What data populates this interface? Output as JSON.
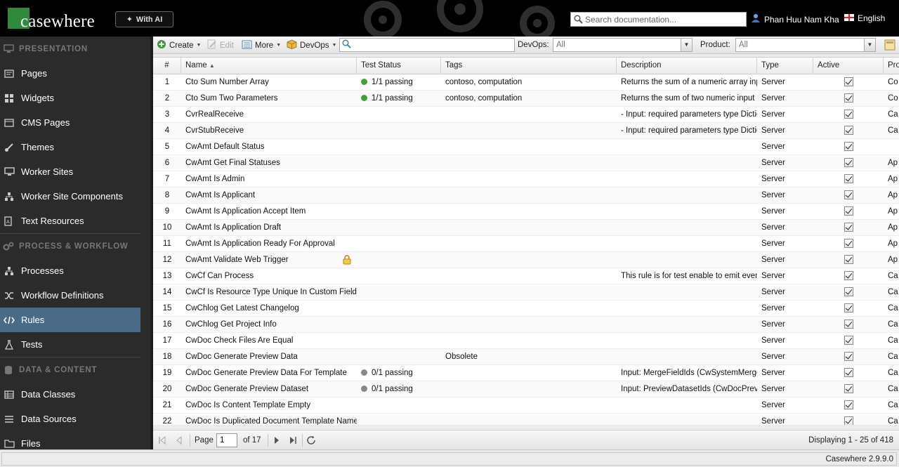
{
  "header": {
    "logo_text": "casewhere",
    "ai_button_label": "With AI",
    "search_placeholder": "Search documentation...",
    "user_name": "Phan Huu Nam Kha",
    "language": "English"
  },
  "sidebar": {
    "sections": [
      {
        "title": "PRESENTATION",
        "icon": "monitor-icon",
        "items": [
          {
            "label": "Pages",
            "icon": "pages-icon"
          },
          {
            "label": "Widgets",
            "icon": "widgets-icon"
          },
          {
            "label": "CMS Pages",
            "icon": "cms-pages-icon"
          },
          {
            "label": "Themes",
            "icon": "brush-icon"
          },
          {
            "label": "Worker Sites",
            "icon": "monitor-icon"
          },
          {
            "label": "Worker Site Components",
            "icon": "sitemap-icon"
          },
          {
            "label": "Text Resources",
            "icon": "text-resources-icon"
          }
        ]
      },
      {
        "title": "PROCESS & WORKFLOW",
        "icon": "gears-icon",
        "items": [
          {
            "label": "Processes",
            "icon": "sitemap-icon"
          },
          {
            "label": "Workflow Definitions",
            "icon": "shuffle-icon"
          },
          {
            "label": "Rules",
            "icon": "code-icon",
            "active": true
          },
          {
            "label": "Tests",
            "icon": "flask-icon"
          }
        ]
      },
      {
        "title": "DATA & CONTENT",
        "icon": "database-icon",
        "items": [
          {
            "label": "Data Classes",
            "icon": "table-icon"
          },
          {
            "label": "Data Sources",
            "icon": "list-icon"
          },
          {
            "label": "Files",
            "icon": "folder-icon"
          }
        ]
      }
    ]
  },
  "toolbar": {
    "create_label": "Create",
    "edit_label": "Edit",
    "more_label": "More",
    "devops_label": "DevOps",
    "filter_value": "",
    "devops_filter_label": "DevOps:",
    "devops_filter_value": "All",
    "product_filter_label": "Product:",
    "product_filter_value": "All"
  },
  "grid": {
    "columns": [
      "#",
      "Name",
      "Test Status",
      "Tags",
      "Description",
      "Type",
      "Active",
      "Pro"
    ],
    "sort_indicator": "▲",
    "rows": [
      {
        "n": "1",
        "name": "Cto Sum Number Array",
        "status": "1/1 passing",
        "status_color": "green",
        "tags": "contoso, computation",
        "description": "Returns the sum of a numeric array input",
        "type": "Server",
        "active": true,
        "product": "Co",
        "lock": false
      },
      {
        "n": "2",
        "name": "Cto Sum Two Parameters",
        "status": "1/1 passing",
        "status_color": "green",
        "tags": "contoso, computation",
        "description": "Returns the sum of two numeric input pa",
        "type": "Server",
        "active": true,
        "product": "Co",
        "lock": false
      },
      {
        "n": "3",
        "name": "CvrRealReceive",
        "status": "",
        "status_color": "",
        "tags": "",
        "description": "- Input: required parameters type Dictio",
        "type": "Server",
        "active": true,
        "product": "Ca",
        "lock": false
      },
      {
        "n": "4",
        "name": "CvrStubReceive",
        "status": "",
        "status_color": "",
        "tags": "",
        "description": "- Input: required parameters type Dictio",
        "type": "Server",
        "active": true,
        "product": "Ca",
        "lock": false
      },
      {
        "n": "5",
        "name": "CwAmt Default Status",
        "status": "",
        "status_color": "",
        "tags": "",
        "description": "",
        "type": "Server",
        "active": true,
        "product": "",
        "lock": false
      },
      {
        "n": "6",
        "name": "CwAmt Get Final Statuses",
        "status": "",
        "status_color": "",
        "tags": "",
        "description": "",
        "type": "Server",
        "active": true,
        "product": "Ap",
        "lock": false
      },
      {
        "n": "7",
        "name": "CwAmt Is Admin",
        "status": "",
        "status_color": "",
        "tags": "",
        "description": "",
        "type": "Server",
        "active": true,
        "product": "Ap",
        "lock": false
      },
      {
        "n": "8",
        "name": "CwAmt Is Applicant",
        "status": "",
        "status_color": "",
        "tags": "",
        "description": "",
        "type": "Server",
        "active": true,
        "product": "Ap",
        "lock": false
      },
      {
        "n": "9",
        "name": "CwAmt Is Application Accept Item",
        "status": "",
        "status_color": "",
        "tags": "",
        "description": "",
        "type": "Server",
        "active": true,
        "product": "Ap",
        "lock": false
      },
      {
        "n": "10",
        "name": "CwAmt Is Application Draft",
        "status": "",
        "status_color": "",
        "tags": "",
        "description": "",
        "type": "Server",
        "active": true,
        "product": "Ap",
        "lock": false
      },
      {
        "n": "11",
        "name": "CwAmt Is Application Ready For Approval",
        "status": "",
        "status_color": "",
        "tags": "",
        "description": "",
        "type": "Server",
        "active": true,
        "product": "Ap",
        "lock": false
      },
      {
        "n": "12",
        "name": "CwAmt Validate Web Trigger",
        "status": "",
        "status_color": "",
        "tags": "",
        "description": "",
        "type": "Server",
        "active": true,
        "product": "Ap",
        "lock": true
      },
      {
        "n": "13",
        "name": "CwCf Can Process",
        "status": "",
        "status_color": "",
        "tags": "",
        "description": "This rule is for test enable to emit event",
        "type": "Server",
        "active": true,
        "product": "Ca",
        "lock": false
      },
      {
        "n": "14",
        "name": "CwCf Is Resource Type Unique In Custom Field Co",
        "status": "",
        "status_color": "",
        "tags": "",
        "description": "",
        "type": "Server",
        "active": true,
        "product": "Ca",
        "lock": false
      },
      {
        "n": "15",
        "name": "CwChlog Get Latest Changelog",
        "status": "",
        "status_color": "",
        "tags": "",
        "description": "",
        "type": "Server",
        "active": true,
        "product": "Ca",
        "lock": false
      },
      {
        "n": "16",
        "name": "CwChlog Get Project Info",
        "status": "",
        "status_color": "",
        "tags": "",
        "description": "",
        "type": "Server",
        "active": true,
        "product": "Ca",
        "lock": false
      },
      {
        "n": "17",
        "name": "CwDoc Check Files Are Equal",
        "status": "",
        "status_color": "",
        "tags": "",
        "description": "",
        "type": "Server",
        "active": true,
        "product": "Ca",
        "lock": false
      },
      {
        "n": "18",
        "name": "CwDoc Generate Preview Data",
        "status": "",
        "status_color": "",
        "tags": "Obsolete",
        "description": "",
        "type": "Server",
        "active": true,
        "product": "Ca",
        "lock": false
      },
      {
        "n": "19",
        "name": "CwDoc Generate Preview Data For Template",
        "status": "0/1 passing",
        "status_color": "grey",
        "tags": "",
        "description": "Input: MergeFieldIds (CwSystemMergeF",
        "type": "Server",
        "active": true,
        "product": "Ca",
        "lock": false
      },
      {
        "n": "20",
        "name": "CwDoc Generate Preview Dataset",
        "status": "0/1 passing",
        "status_color": "grey",
        "tags": "",
        "description": "Input: PreviewDatasetIds (CwDocPrevie",
        "type": "Server",
        "active": true,
        "product": "Ca",
        "lock": false
      },
      {
        "n": "21",
        "name": "CwDoc Is Content Template Empty",
        "status": "",
        "status_color": "",
        "tags": "",
        "description": "",
        "type": "Server",
        "active": true,
        "product": "Ca",
        "lock": false
      },
      {
        "n": "22",
        "name": "CwDoc Is Duplicated Document Template Name",
        "status": "",
        "status_color": "",
        "tags": "",
        "description": "",
        "type": "Server",
        "active": true,
        "product": "Ca",
        "lock": false
      }
    ]
  },
  "pager": {
    "page_label": "Page",
    "page_value": "1",
    "of_label": "of 17",
    "display_text": "Displaying 1 - 25 of 418"
  },
  "footer": {
    "version": "Casewhere 2.9.9.0"
  },
  "colors": {
    "accent": "#4a6a85",
    "sidebar_bg": "#2b2b2b",
    "brand_green": "#2f8a3a",
    "status_green": "#3ca33c",
    "status_grey": "#888888"
  }
}
